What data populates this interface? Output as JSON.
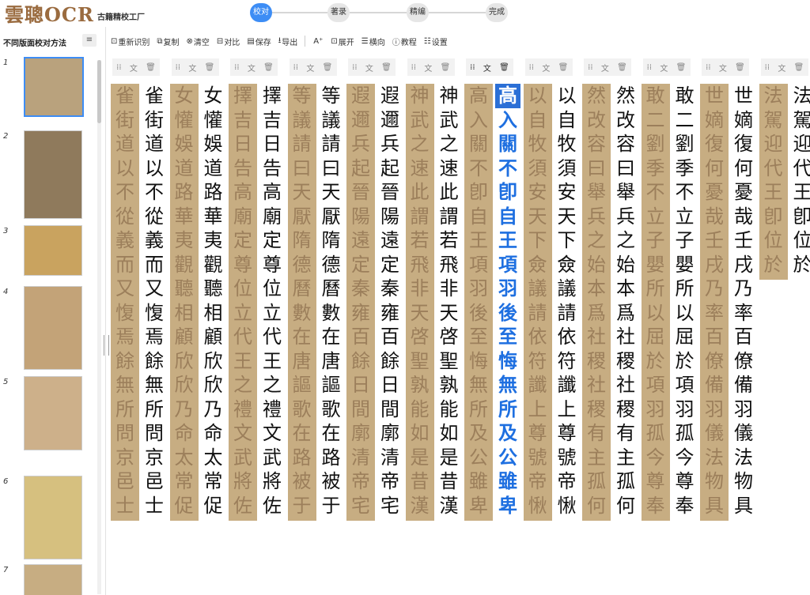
{
  "header": {
    "logo_main": "雲聰OCR",
    "logo_sub": "古籍精校工厂",
    "steps": [
      "校对",
      "著录",
      "精编",
      "完成"
    ],
    "active_step": 0
  },
  "sidebar": {
    "title": "不同版面校对方法",
    "menu_icon": "menu-icon",
    "thumbnails": [
      {
        "num": "1"
      },
      {
        "num": "2"
      },
      {
        "num": "3"
      },
      {
        "num": "4"
      },
      {
        "num": "5"
      },
      {
        "num": "6"
      },
      {
        "num": "7"
      }
    ],
    "selected_index": 0
  },
  "toolbar": {
    "items": [
      {
        "icon": "⊡",
        "label": "重新识别"
      },
      {
        "icon": "⧉",
        "label": "复制"
      },
      {
        "icon": "⊗",
        "label": "清空"
      },
      {
        "icon": "⊟",
        "label": "对比"
      },
      {
        "icon": "▤",
        "label": "保存"
      },
      {
        "icon": "⭳",
        "label": "导出"
      },
      {
        "icon": "A⁺",
        "label": ""
      },
      {
        "icon": "⊡",
        "label": "展开"
      },
      {
        "icon": "☰",
        "label": "横向"
      },
      {
        "icon": "ⓘ",
        "label": "教程"
      },
      {
        "icon": "☷",
        "label": "设置"
      }
    ]
  },
  "column_header": {
    "drag": "⁞⁞",
    "text": "文",
    "trash": "🗑"
  },
  "columns": [
    {
      "text": "法駕迎代王卽位於"
    },
    {
      "text": "世嫡復何憂哉壬戌乃率百僚備羽儀法物具"
    },
    {
      "text": "敢二劉季不立子嬰所以屈於項羽孤今尊奉"
    },
    {
      "text": "然改容曰舉兵之始本爲社稷社稷有主孤何"
    },
    {
      "text": "以自牧須安天下僉議請依符讖上尊號帝愀"
    },
    {
      "text": "高入關不卽自王項羽後至悔無所及公雖卑",
      "highlight": true
    },
    {
      "text": "神武之速此謂若飛非天啓聖孰能如是昔漢"
    },
    {
      "text": "遐邇兵起晉陽遠定秦雍百餘日間廓清帝宅"
    },
    {
      "text": "等議請曰天厭隋德曆數在唐謳歌在路被于"
    },
    {
      "text": "擇吉日告高廟定尊位立代王之禮文武將佐"
    },
    {
      "text": "女懽娛道路華夷觀聽相顧欣欣乃命太常促"
    },
    {
      "text": "雀街道以不從義而又愎焉餘無所問京邑士"
    }
  ]
}
